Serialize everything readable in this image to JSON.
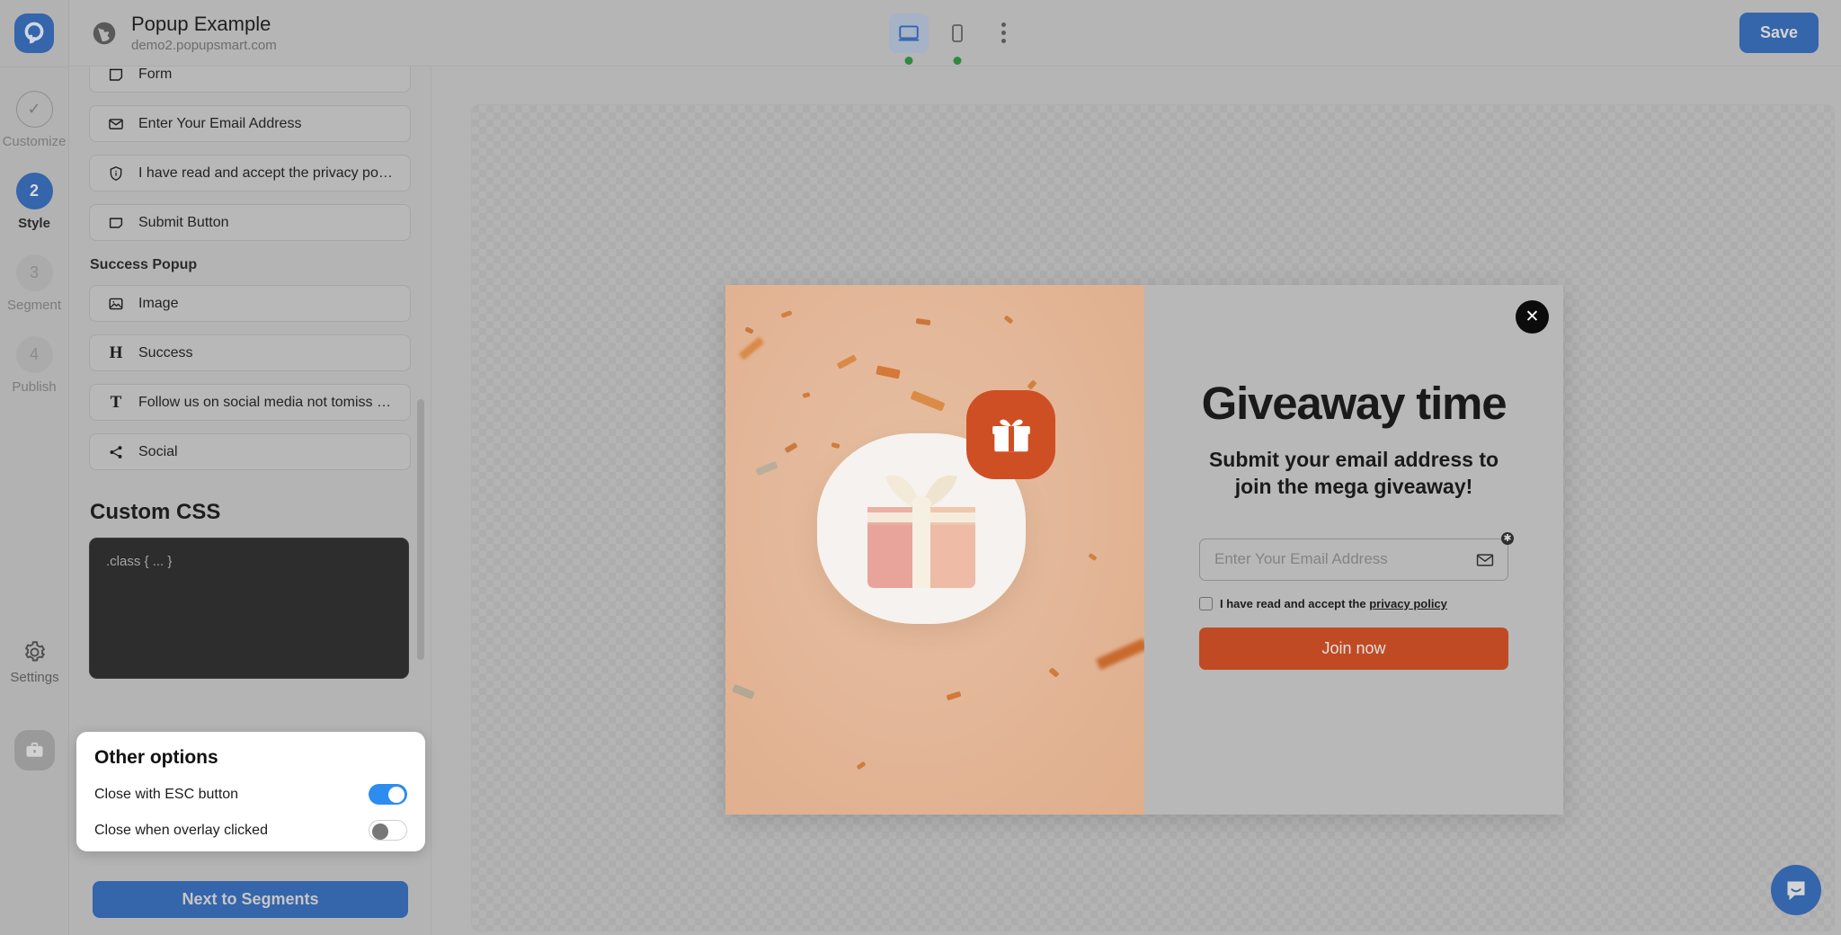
{
  "brand": {
    "logo": "popupsmart-logo-icon",
    "accent": "#3565ab",
    "toggle_on": "#2d8cf0"
  },
  "rail": {
    "steps": [
      {
        "badge": "✓",
        "label": "Customize",
        "state": "done"
      },
      {
        "badge": "2",
        "label": "Style",
        "state": "active"
      },
      {
        "badge": "3",
        "label": "Segment",
        "state": "idle"
      },
      {
        "badge": "4",
        "label": "Publish",
        "state": "idle"
      }
    ],
    "settings_label": "Settings"
  },
  "topbar": {
    "site_title": "Popup Example",
    "site_url": "demo2.popupsmart.com",
    "devices": [
      {
        "name": "desktop",
        "active": true,
        "status": "online"
      },
      {
        "name": "mobile",
        "active": false,
        "status": "online"
      }
    ],
    "more_label": "⋮",
    "save_label": "Save"
  },
  "editor": {
    "layers": [
      {
        "icon": "form-icon",
        "label": "Form"
      },
      {
        "icon": "mail-icon",
        "label": "Enter Your Email Address"
      },
      {
        "icon": "shield-icon",
        "label": "I have read and accept the privacy policy"
      },
      {
        "icon": "button-icon",
        "label": "Submit Button"
      }
    ],
    "success_section_title": "Success Popup",
    "success_layers": [
      {
        "icon": "image-icon",
        "label": "Image"
      },
      {
        "icon": "heading-icon",
        "label": "Success"
      },
      {
        "icon": "text-icon",
        "label": "Follow us on social media not tomiss the..."
      },
      {
        "icon": "share-icon",
        "label": "Social"
      }
    ],
    "custom_css_title": "Custom CSS",
    "custom_css_placeholder": ".class { ... }",
    "custom_css_value": ""
  },
  "other_options": {
    "title": "Other options",
    "rows": [
      {
        "label": "Close with ESC button",
        "on": true
      },
      {
        "label": "Close when overlay clicked",
        "on": false
      }
    ]
  },
  "next_button_label": "Next to Segments",
  "popup": {
    "close_label": "✕",
    "heading": "Giveaway time",
    "subheading_line1": "Submit your email address to",
    "subheading_line2": "join the mega giveaway!",
    "email_placeholder": "Enter Your Email Address",
    "email_value": "",
    "required_marker": "✱",
    "consent_text": "I have read and accept the ",
    "consent_link": "privacy policy",
    "consent_checked": false,
    "cta_label": "Join now",
    "image_alt": "gift-box-illustration",
    "accent_color": "#c04a23"
  },
  "chat": {
    "icon": "chat-bubble-icon"
  }
}
